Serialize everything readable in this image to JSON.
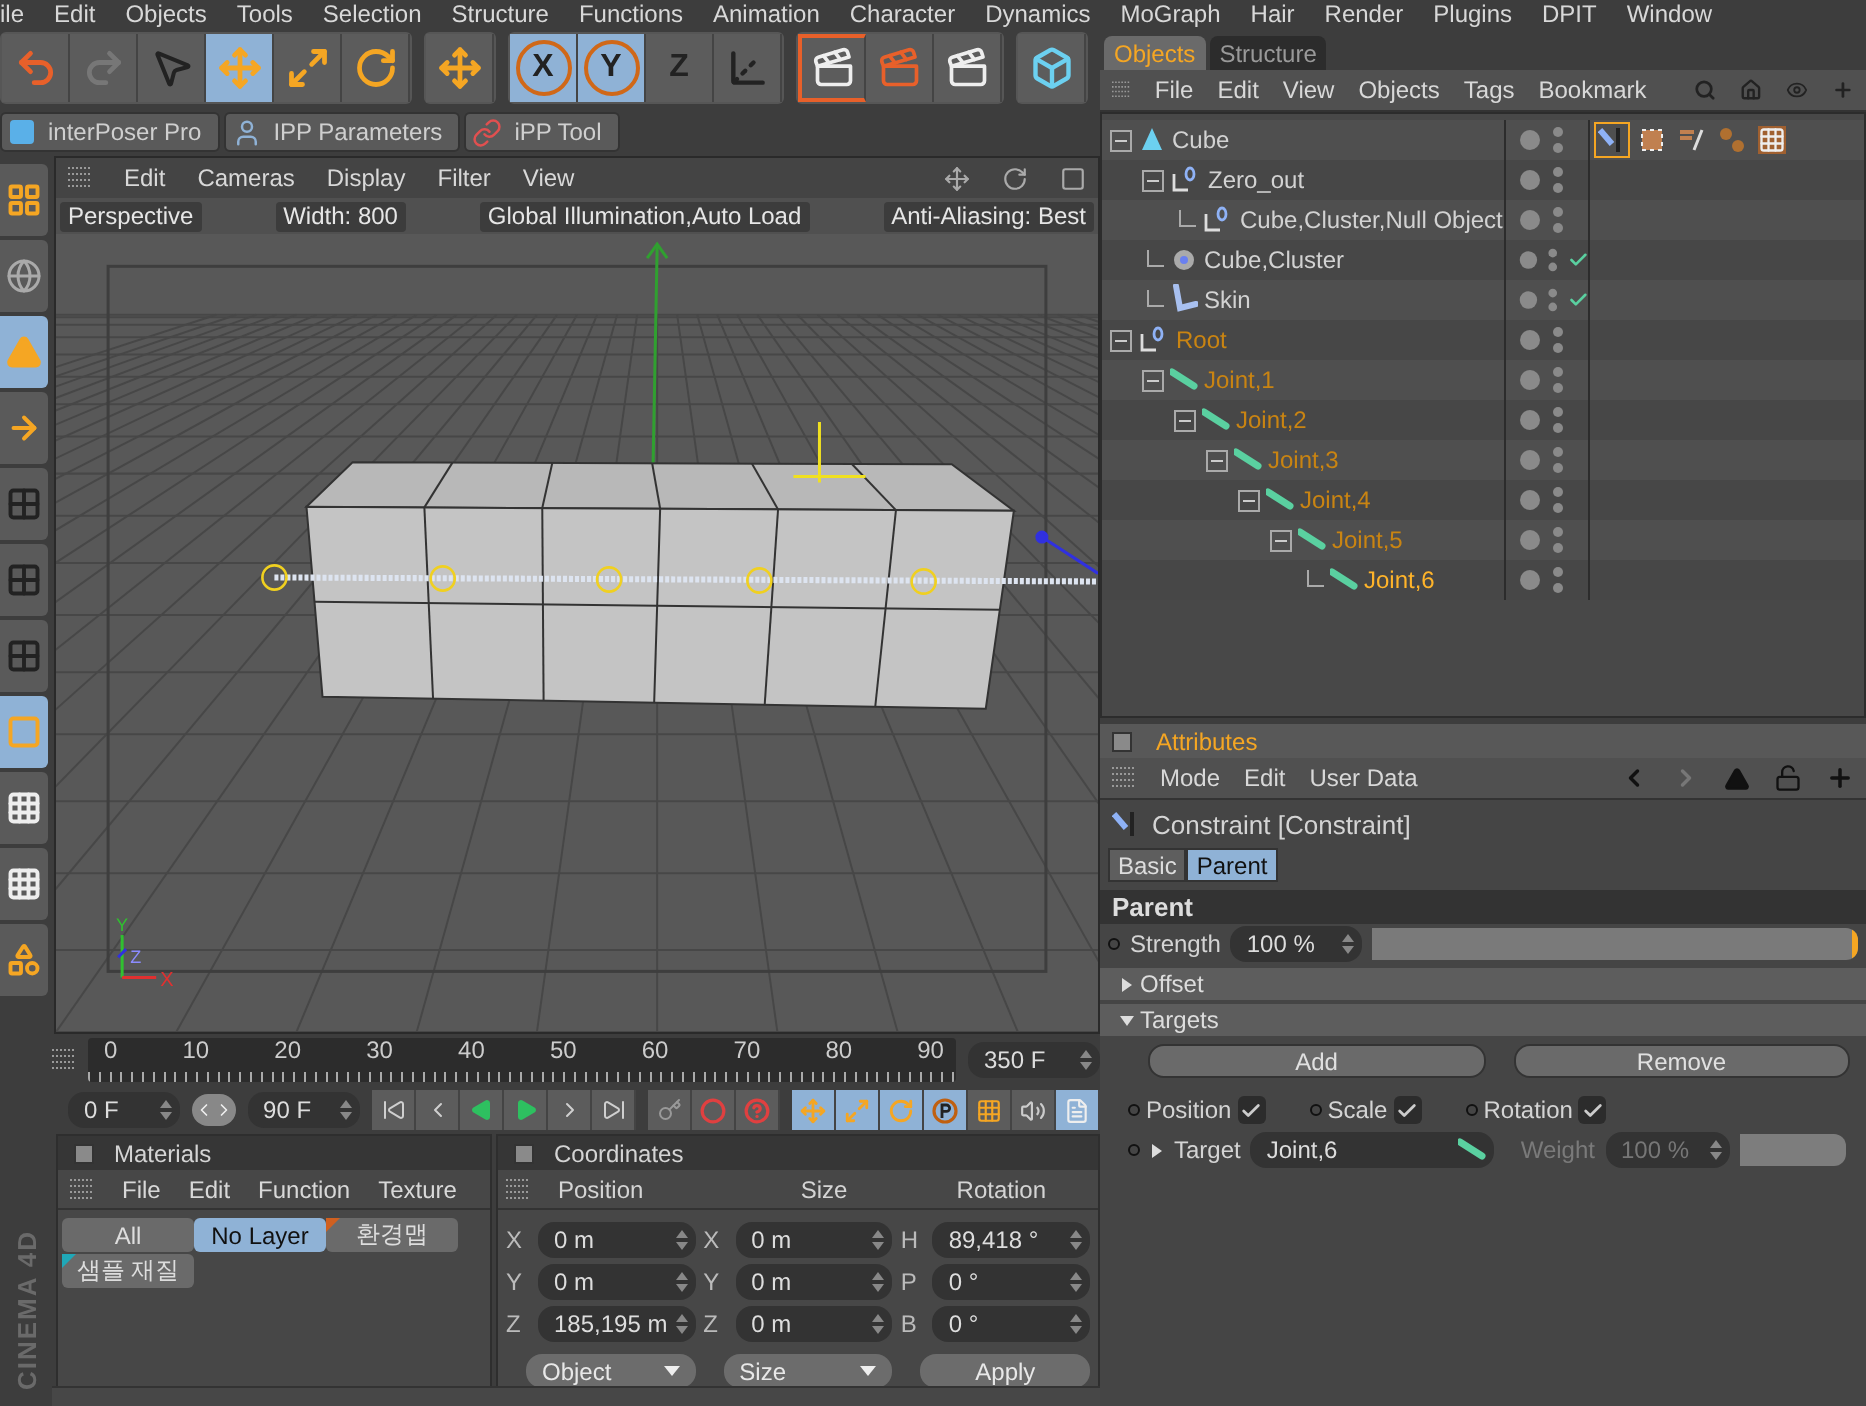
{
  "menu_bar": {
    "items": [
      "ile",
      "Edit",
      "Objects",
      "Tools",
      "Selection",
      "Structure",
      "Functions",
      "Animation",
      "Character",
      "Dynamics",
      "MoGraph",
      "Hair",
      "Render",
      "Plugins",
      "DPIT",
      "Window"
    ]
  },
  "toolbar": [
    [
      {
        "kind": "undo",
        "selected": false
      },
      {
        "kind": "redo",
        "selected": false
      },
      {
        "kind": "live-select",
        "selected": false
      },
      {
        "kind": "move",
        "selected": true
      },
      {
        "kind": "scale",
        "selected": false
      },
      {
        "kind": "rotate",
        "selected": false
      }
    ],
    [
      {
        "kind": "move",
        "selected": false
      }
    ],
    [
      {
        "kind": "axis",
        "label": "X",
        "selected": true
      },
      {
        "kind": "axis",
        "label": "Y",
        "selected": true
      },
      {
        "kind": "axis",
        "label": "Z",
        "selected": false
      },
      {
        "kind": "coords",
        "selected": false
      }
    ],
    [
      {
        "kind": "render-view",
        "selected": false
      },
      {
        "kind": "render",
        "selected": false
      },
      {
        "kind": "render-queue",
        "selected": false
      }
    ],
    [
      {
        "kind": "cube",
        "selected": false
      }
    ]
  ],
  "plugin_tabs": [
    {
      "label": "interPoser Pro",
      "kind": "logo"
    },
    {
      "label": "IPP Parameters",
      "kind": "figure"
    },
    {
      "label": "iPP Tool",
      "kind": "rings"
    }
  ],
  "left_tools": [
    {
      "kind": "layout",
      "selected": false
    },
    {
      "kind": "globe",
      "selected": false
    },
    {
      "kind": "model",
      "selected": true
    },
    {
      "kind": "object-axis",
      "selected": false
    },
    {
      "kind": "points",
      "selected": false
    },
    {
      "kind": "edges",
      "selected": false
    },
    {
      "kind": "polygons",
      "selected": false
    },
    {
      "kind": "uv",
      "selected": true
    },
    {
      "kind": "texture",
      "selected": false
    },
    {
      "kind": "texture-axis",
      "selected": false
    },
    {
      "kind": "primitives",
      "selected": false
    }
  ],
  "viewport": {
    "menu": [
      "Edit",
      "Cameras",
      "Display",
      "Filter",
      "View"
    ],
    "hud": [
      "Perspective",
      "Width:  800",
      "Global Illumination,Auto Load",
      "Anti-Aliasing: Best"
    ],
    "axis_labels": [
      "Y",
      "Z",
      "X"
    ]
  },
  "timeline": {
    "labels": [
      "0",
      "10",
      "20",
      "30",
      "40",
      "50",
      "60",
      "70",
      "80",
      "90"
    ],
    "end_frame": "350 F",
    "start_field": "0 F",
    "end_field": "90 F",
    "transport": [
      {
        "kind": "first"
      },
      {
        "kind": "prev-key"
      },
      {
        "kind": "play-back"
      },
      {
        "kind": "play"
      },
      {
        "kind": "next-key"
      },
      {
        "kind": "last"
      }
    ],
    "record": [
      {
        "kind": "autokey"
      },
      {
        "kind": "record"
      },
      {
        "kind": "help"
      }
    ],
    "keys": [
      {
        "kind": "move",
        "selected": true
      },
      {
        "kind": "scale",
        "selected": true
      },
      {
        "kind": "rotate",
        "selected": true
      },
      {
        "kind": "param",
        "selected": true
      },
      {
        "kind": "points",
        "selected": false
      },
      {
        "kind": "sound",
        "selected": false
      },
      {
        "kind": "doc",
        "selected": true
      }
    ]
  },
  "materials": {
    "title": "Materials",
    "menu": [
      "File",
      "Edit",
      "Function",
      "Texture"
    ],
    "layers": [
      {
        "label": "All",
        "selected": false
      },
      {
        "label": "No Layer",
        "selected": true
      },
      {
        "label": "환경맵",
        "selected": false,
        "color": "#d06020"
      },
      {
        "label": "샘플 재질",
        "selected": false,
        "color": "#20a8b8"
      }
    ]
  },
  "coordinates": {
    "title": "Coordinates",
    "columns": [
      "Position",
      "Size",
      "Rotation"
    ],
    "rows": [
      [
        {
          "axis": "X",
          "value": "0 m"
        },
        {
          "axis": "X",
          "value": "0 m"
        },
        {
          "axis": "H",
          "value": "89,418 °"
        }
      ],
      [
        {
          "axis": "Y",
          "value": "0 m"
        },
        {
          "axis": "Y",
          "value": "0 m"
        },
        {
          "axis": "P",
          "value": "0 °"
        }
      ],
      [
        {
          "axis": "Z",
          "value": "185,195 m"
        },
        {
          "axis": "Z",
          "value": "0 m"
        },
        {
          "axis": "B",
          "value": "0 °"
        }
      ]
    ],
    "buttons": [
      {
        "kind": "dropdown",
        "label": "Object"
      },
      {
        "kind": "dropdown",
        "label": "Size"
      },
      {
        "kind": "button",
        "label": "Apply"
      }
    ]
  },
  "logo": {
    "text": "CINEMA 4D"
  },
  "objects": {
    "tabs": [
      {
        "label": "Objects",
        "selected": true
      },
      {
        "label": "Structure",
        "selected": false
      }
    ],
    "menu": [
      "File",
      "Edit",
      "View",
      "Objects",
      "Tags",
      "Bookmark"
    ],
    "tree": [
      {
        "name": "Cube",
        "kind": "cube",
        "expanded": true,
        "selected": false,
        "active": false,
        "check": false,
        "tags": [
          {
            "kind": "constraint",
            "selected": true
          },
          {
            "kind": "cluster",
            "selected": false
          },
          {
            "kind": "weight",
            "selected": false
          },
          {
            "kind": "balls",
            "selected": false
          },
          {
            "kind": "texture",
            "selected": false
          }
        ],
        "children": [
          {
            "name": "Zero_out",
            "kind": "null",
            "expanded": true,
            "selected": false,
            "active": false,
            "check": false,
            "children": [
              {
                "name": "Cube,Cluster,Null Object",
                "kind": "null",
                "selected": false,
                "active": false,
                "check": false
              }
            ]
          },
          {
            "name": "Cube,Cluster",
            "kind": "cluster",
            "selected": false,
            "active": false,
            "check": true
          },
          {
            "name": "Skin",
            "kind": "skin",
            "selected": false,
            "active": false,
            "check": true
          }
        ]
      },
      {
        "name": "Root",
        "kind": "null",
        "expanded": true,
        "selected": true,
        "active": false,
        "check": false,
        "children": [
          {
            "name": "Joint,1",
            "kind": "joint",
            "expanded": true,
            "selected": true,
            "active": false,
            "check": false,
            "children": [
              {
                "name": "Joint,2",
                "kind": "joint",
                "expanded": true,
                "selected": true,
                "active": false,
                "check": false,
                "children": [
                  {
                    "name": "Joint,3",
                    "kind": "joint",
                    "expanded": true,
                    "selected": true,
                    "active": false,
                    "check": false,
                    "children": [
                      {
                        "name": "Joint,4",
                        "kind": "joint",
                        "expanded": true,
                        "selected": true,
                        "active": false,
                        "check": false,
                        "children": [
                          {
                            "name": "Joint,5",
                            "kind": "joint",
                            "expanded": true,
                            "selected": true,
                            "active": false,
                            "check": false,
                            "children": [
                              {
                                "name": "Joint,6",
                                "kind": "joint",
                                "selected": true,
                                "active": true,
                                "check": false
                              }
                            ]
                          }
                        ]
                      }
                    ]
                  }
                ]
              }
            ]
          }
        ]
      }
    ]
  },
  "attributes": {
    "title": "Attributes",
    "menu": [
      "Mode",
      "Edit",
      "User Data"
    ],
    "object_title": "Constraint [Constraint]",
    "tabs": [
      {
        "label": "Basic",
        "selected": false
      },
      {
        "label": "Parent",
        "selected": true
      }
    ],
    "section": "Parent",
    "strength": {
      "label": "Strength",
      "value": "100 %",
      "level": 1
    },
    "groups": [
      {
        "label": "Offset",
        "expanded": false
      },
      {
        "label": "Targets",
        "expanded": true
      }
    ],
    "buttons": [
      "Add",
      "Remove"
    ],
    "checks": [
      {
        "label": "Position",
        "checked": true
      },
      {
        "label": "Scale",
        "checked": true
      },
      {
        "label": "Rotation",
        "checked": true
      }
    ],
    "target": {
      "label": "Target",
      "value": "Joint,6"
    },
    "weight": {
      "label": "Weight",
      "value": "100 %",
      "level": 1,
      "disabled": true
    }
  }
}
